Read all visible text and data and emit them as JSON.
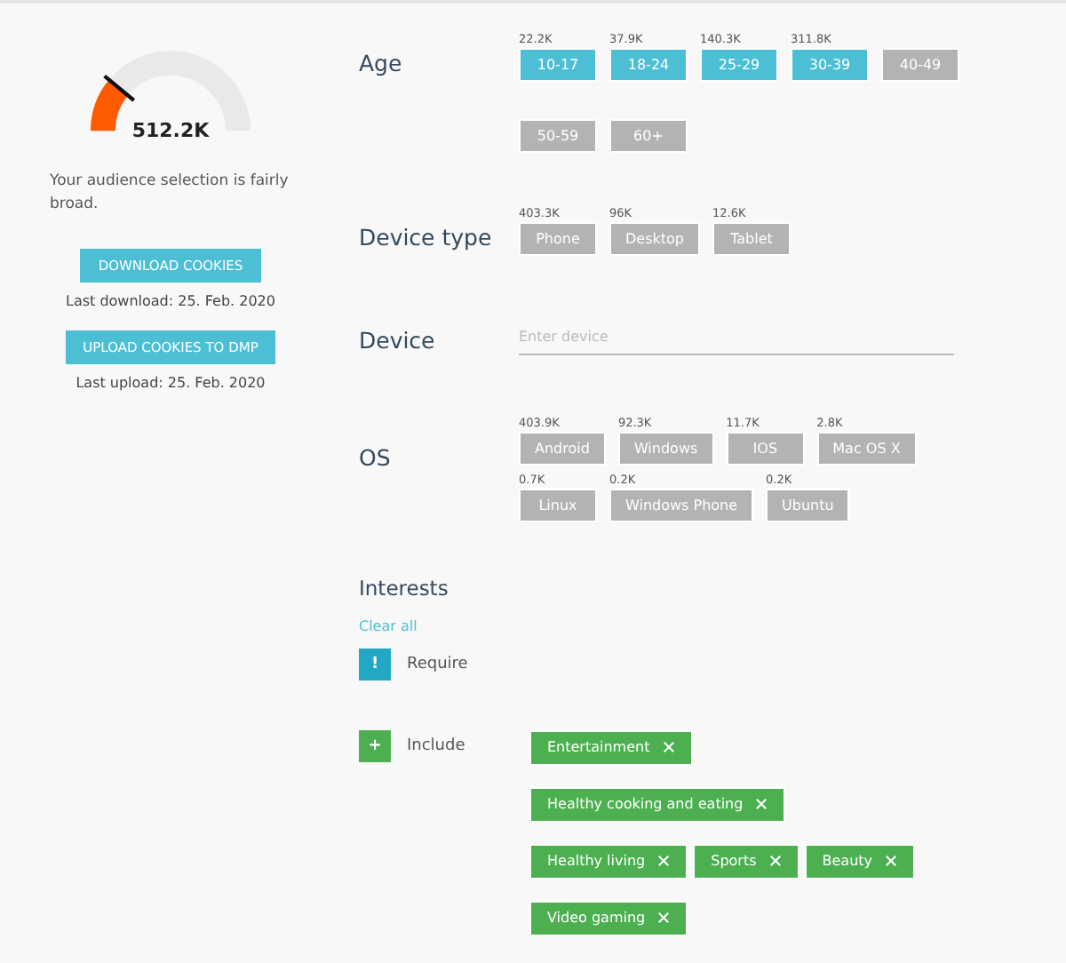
{
  "summary": {
    "gauge": {
      "value": "512.2K"
    },
    "message": "Your audience selection is fairly broad.",
    "actions": [
      {
        "label": "DOWNLOAD COOKIES",
        "note": "Last download: 25. Feb. 2020"
      },
      {
        "label": "UPLOAD COOKIES TO DMP",
        "note": "Last upload: 25. Feb. 2020"
      }
    ]
  },
  "filters": [
    {
      "kind": "options",
      "label": "Age",
      "options": [
        {
          "count": "22.2K",
          "label": "10-17",
          "selected": true
        },
        {
          "count": "37.9K",
          "label": "18-24",
          "selected": true
        },
        {
          "count": "140.3K",
          "label": "25-29",
          "selected": true
        },
        {
          "count": "311.8K",
          "label": "30-39",
          "selected": true
        },
        {
          "label": "40-49",
          "selected": false
        },
        {
          "label": "50-59",
          "selected": false
        },
        {
          "label": "60+",
          "selected": false
        }
      ]
    },
    {
      "kind": "options",
      "label": "Device type",
      "options": [
        {
          "count": "403.3K",
          "label": "Phone",
          "selected": false
        },
        {
          "count": "96K",
          "label": "Desktop",
          "selected": false
        },
        {
          "count": "12.6K",
          "label": "Tablet",
          "selected": false
        }
      ]
    },
    {
      "kind": "input",
      "label": "Device",
      "placeholder": "Enter device"
    },
    {
      "kind": "options",
      "label": "OS",
      "options": [
        {
          "count": "403.9K",
          "label": "Android",
          "selected": false
        },
        {
          "count": "92.3K",
          "label": "Windows",
          "selected": false
        },
        {
          "count": "11.7K",
          "label": "IOS",
          "selected": false
        },
        {
          "count": "2.8K",
          "label": "Mac OS X",
          "selected": false
        },
        {
          "count": "0.7K",
          "label": "Linux",
          "selected": false
        },
        {
          "count": "0.2K",
          "label": "Windows Phone",
          "selected": false
        },
        {
          "count": "0.2K",
          "label": "Ubuntu",
          "selected": false
        }
      ]
    }
  ],
  "interests": {
    "title": "Interests",
    "clear": "Clear all",
    "groups": [
      {
        "kind": "require",
        "symbol": "!",
        "label": "Require"
      },
      {
        "kind": "include",
        "symbol": "+",
        "label": "Include",
        "tags": [
          {
            "label": "Entertainment"
          },
          {
            "label": "Healthy cooking and eating"
          },
          {
            "label": "Healthy living"
          },
          {
            "label": "Sports"
          },
          {
            "label": "Beauty"
          },
          {
            "label": "Video gaming"
          }
        ]
      }
    ]
  }
}
